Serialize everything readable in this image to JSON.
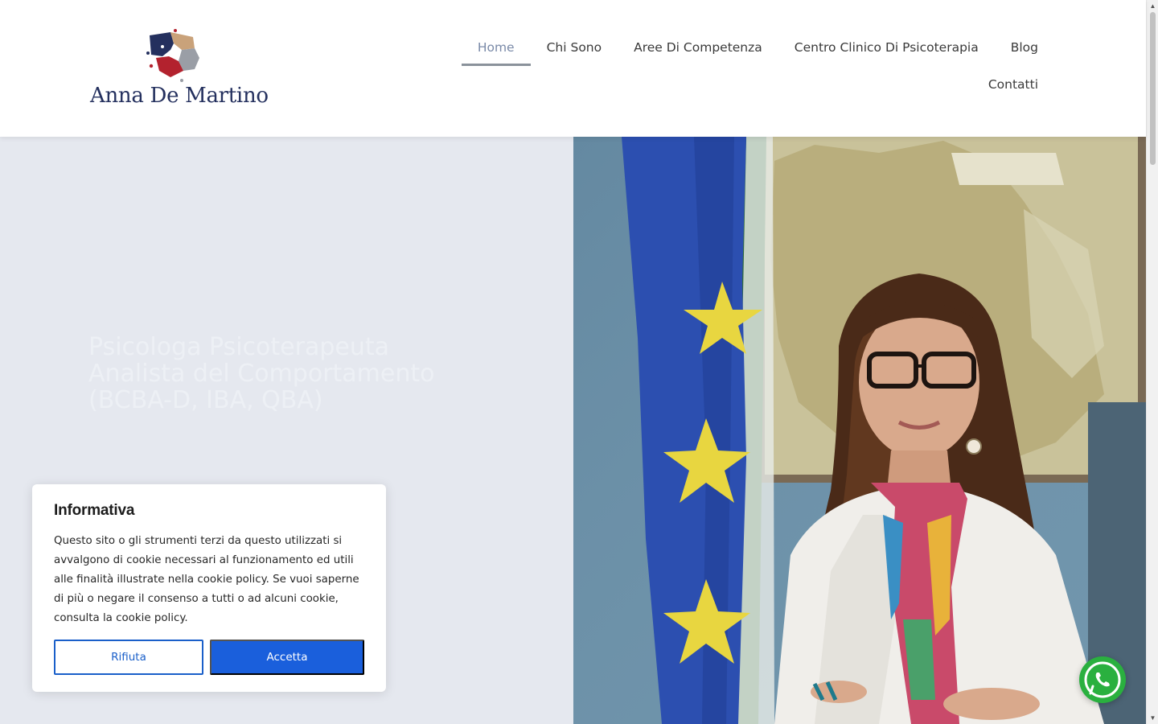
{
  "brand": {
    "name": "Anna De Martino"
  },
  "nav": {
    "items": [
      {
        "label": "Home",
        "active": true
      },
      {
        "label": "Chi Sono",
        "active": false
      },
      {
        "label": "Aree Di Competenza",
        "active": false
      },
      {
        "label": "Centro Clinico Di Psicoterapia",
        "active": false
      },
      {
        "label": "Blog",
        "active": false
      },
      {
        "label": "Contatti",
        "active": false
      }
    ]
  },
  "hero": {
    "title": "Psicologa Psicoterapeuta Analista del Comportamento (BCBA-D, IBA, QBA)",
    "subtitle": ""
  },
  "cookie": {
    "title": "Informativa",
    "text": "Questo sito o gli strumenti terzi da questo utilizzati si avvalgono di cookie necessari al funzionamento ed utili alle finalità illustrate nella cookie policy. Se vuoi saperne di più o negare il consenso a tutti o ad alcuni cookie, consulta la cookie policy.",
    "reject_label": "Rifiuta",
    "accept_label": "Accetta"
  },
  "colors": {
    "accent": "#1a5fdc",
    "brand_navy": "#24305e",
    "hero_bg": "#e5e8ef",
    "whatsapp": "#2ab03f"
  },
  "icons": {
    "whatsapp": "whatsapp-icon",
    "logo": "puzzle-logo-icon"
  }
}
